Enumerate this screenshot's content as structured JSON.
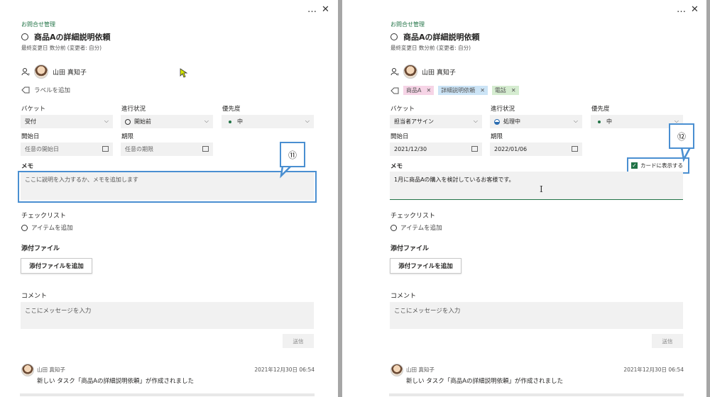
{
  "toolbar": {
    "more_icon": "…",
    "close_icon": "✕"
  },
  "left": {
    "header": "お問合せ管理",
    "title": "商品Aの詳細説明依頼",
    "modified": "最終変更日 数分前 (変更者: 自分)",
    "assignee": "山田 真知子",
    "label_add": "ラベルを追加",
    "bucket_label": "バケット",
    "bucket_value": "受付",
    "progress_label": "進行状況",
    "progress_value": "開始前",
    "priority_label": "優先度",
    "priority_value": "中",
    "start_label": "開始日",
    "start_value": "任意の開始日",
    "due_label": "期限",
    "due_value": "任意の期限",
    "memo_label": "メモ",
    "memo_placeholder": "ここに説明を入力するか、メモを追加します",
    "callout": "⑪",
    "checklist_label": "チェックリスト",
    "checklist_add": "アイテムを追加",
    "attach_label": "添付ファイル",
    "attach_button": "添付ファイルを追加",
    "comment_label": "コメント",
    "comment_placeholder": "ここにメッセージを入力",
    "send": "送信",
    "comment_author": "山田 真知子",
    "comment_date": "2021年12月30日 06:54",
    "comment_text": "新しい タスク「商品Aの詳細説明依頼」が作成されました"
  },
  "right": {
    "header": "お問合せ管理",
    "title": "商品Aの詳細説明依頼",
    "modified": "最終変更日 数分前 (変更者: 自分)",
    "assignee": "山田 真知子",
    "tags": [
      {
        "label": "商品A",
        "bg": "#f6d4e6"
      },
      {
        "label": "詳細説明依頼",
        "bg": "#cce4f6"
      },
      {
        "label": "電話",
        "bg": "#d5ecd0"
      }
    ],
    "bucket_label": "バケット",
    "bucket_value": "担当者アサイン",
    "progress_label": "進行状況",
    "progress_value": "処理中",
    "priority_label": "優先度",
    "priority_value": "中",
    "start_label": "開始日",
    "start_value": "2021/12/30",
    "due_label": "期限",
    "due_value": "2022/01/06",
    "memo_label": "メモ",
    "show_on_card": "カードに表示する",
    "memo_text": "1月に商品Aの購入を検討しているお客様です。",
    "callout": "⑫",
    "checklist_label": "チェックリスト",
    "checklist_add": "アイテムを追加",
    "attach_label": "添付ファイル",
    "attach_button": "添付ファイルを追加",
    "comment_label": "コメント",
    "comment_placeholder": "ここにメッセージを入力",
    "send": "送信",
    "comment_author": "山田 真知子",
    "comment_date": "2021年12月30日 06:54",
    "comment_text": "新しい タスク「商品Aの詳細説明依頼」が作成されました"
  },
  "colors": {
    "accent": "#217346",
    "callout": "#4a8fd1"
  }
}
